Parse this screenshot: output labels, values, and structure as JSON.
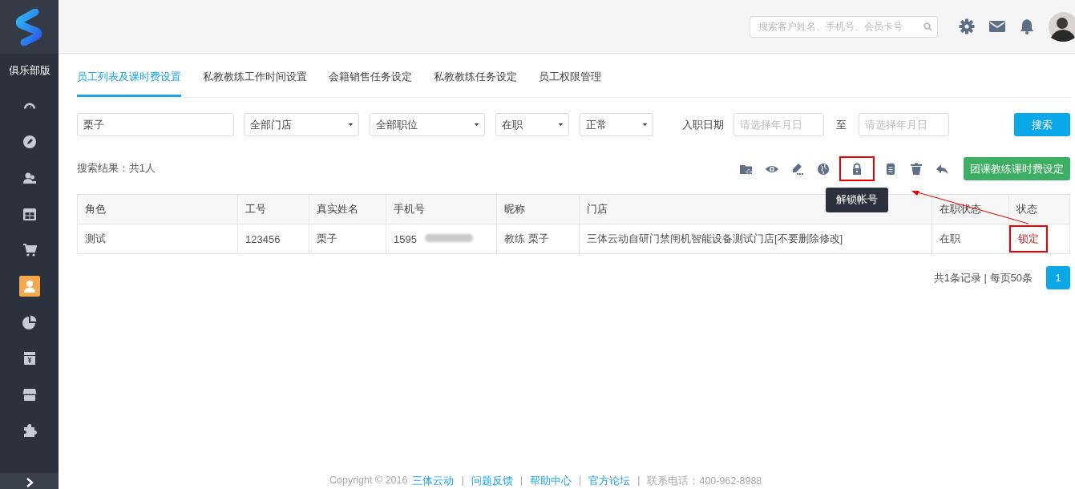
{
  "sidebar": {
    "brand_label": "俱乐部版",
    "items": [
      {
        "selected": false
      },
      {
        "selected": false
      },
      {
        "selected": false
      },
      {
        "selected": false
      },
      {
        "selected": false
      },
      {
        "selected": true
      },
      {
        "selected": false
      },
      {
        "selected": false
      },
      {
        "selected": false
      },
      {
        "selected": false
      }
    ]
  },
  "header": {
    "search": {
      "placeholder": "搜索客户姓名、手机号、会员卡号"
    }
  },
  "tabs": [
    {
      "label": "员工列表及课时费设置",
      "selected": true
    },
    {
      "label": "私教教练工作时间设置",
      "selected": false
    },
    {
      "label": "会籍销售任务设定",
      "selected": false
    },
    {
      "label": "私教教练任务设定",
      "selected": false
    },
    {
      "label": "员工权限管理",
      "selected": false
    }
  ],
  "filters": {
    "name_field": {
      "value": "栗子"
    },
    "dropdowns": [
      {
        "value": "全部门店"
      },
      {
        "value": "全部职位"
      },
      {
        "value": "在职"
      },
      {
        "value": "正常"
      }
    ],
    "date_label": "入职日期",
    "date_from": {
      "placeholder": "请选择年月日"
    },
    "date_separator": "至",
    "date_to": {
      "placeholder": "请选择年月日"
    },
    "search_button": "搜索"
  },
  "toolbar": {
    "result_summary": "搜索结果：共1人",
    "icons": [
      {
        "highlighted": false
      },
      {
        "highlighted": false
      },
      {
        "highlighted": false
      },
      {
        "highlighted": false
      },
      {
        "highlighted": true,
        "tooltip": "解锁帐号"
      },
      {
        "highlighted": false
      },
      {
        "highlighted": false
      },
      {
        "highlighted": false
      }
    ],
    "button": "团课教练课时费设定"
  },
  "table": {
    "columns": [
      "角色",
      "工号",
      "真实姓名",
      "手机号",
      "昵称",
      "门店",
      "在职状态",
      "状态"
    ],
    "rows": [
      {
        "cells": [
          "测试",
          "123456",
          "栗子",
          "1595",
          "教练 栗子",
          "三体云动自研门禁闸机智能设备测试门店[不要删除修改]",
          "在职",
          "锁定"
        ],
        "phone_redacted": true,
        "status_highlighted": true
      }
    ]
  },
  "pagination": {
    "summary": "共1条记录 | 每页50条",
    "pages": [
      {
        "label": "1",
        "selected": true
      }
    ]
  },
  "annotation_arrow": true,
  "footer": [
    {
      "kind": "text",
      "text": "Copyright © 2016"
    },
    {
      "kind": "link",
      "text": "三体云动"
    },
    {
      "kind": "separator",
      "text": "|"
    },
    {
      "kind": "link",
      "text": "问题反馈"
    },
    {
      "kind": "separator",
      "text": "|"
    },
    {
      "kind": "link",
      "text": "帮助中心"
    },
    {
      "kind": "separator",
      "text": "|"
    },
    {
      "kind": "link",
      "text": "官方论坛"
    },
    {
      "kind": "separator",
      "text": "|"
    },
    {
      "kind": "text",
      "text": "联系电话：400-962-8988"
    }
  ]
}
